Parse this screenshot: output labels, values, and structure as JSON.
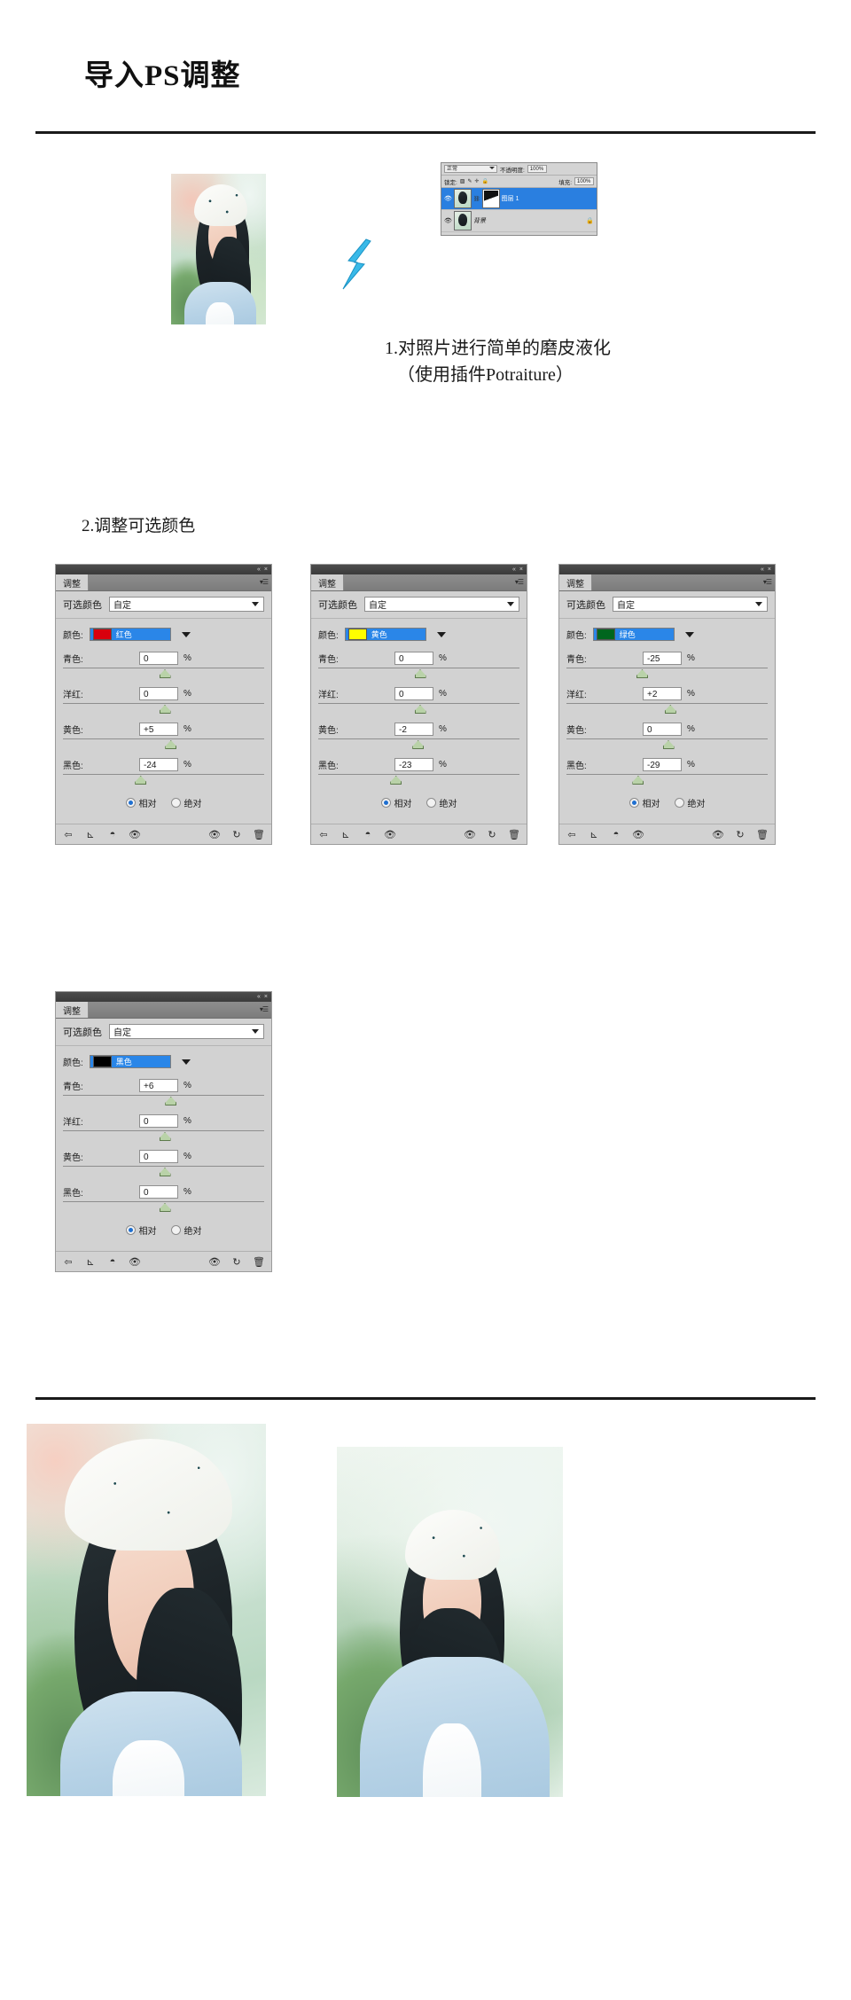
{
  "header": {
    "title": "导入PS调整"
  },
  "steps": {
    "step1_line1": "1.对照片进行简单的磨皮液化",
    "step1_line2": "（使用插件Potraiture）",
    "step2": "2.调整可选颜色"
  },
  "layers_panel": {
    "blend_mode": "正常",
    "opacity_label": "不透明度:",
    "opacity_value": "100%",
    "lock_label": "锁定:",
    "fill_label": "填充:",
    "fill_value": "100%",
    "layers": [
      {
        "name": "图层 1",
        "selected": true,
        "has_mask": true,
        "locked": false
      },
      {
        "name": "背景",
        "selected": false,
        "has_mask": false,
        "locked": true
      }
    ]
  },
  "adjustment_panels": [
    {
      "tab": "调整",
      "title": "可选颜色",
      "preset": "自定",
      "color_label": "颜色:",
      "color_name": "红色",
      "color_hex": "#d9000d",
      "sliders": [
        {
          "label": "青色:",
          "value": "0",
          "unit": "%",
          "pos": 50
        },
        {
          "label": "洋红:",
          "value": "0",
          "unit": "%",
          "pos": 50
        },
        {
          "label": "黄色:",
          "value": "+5",
          "unit": "%",
          "pos": 53
        },
        {
          "label": "黑色:",
          "value": "-24",
          "unit": "%",
          "pos": 38
        }
      ],
      "mode_relative": "相对",
      "mode_absolute": "绝对",
      "mode_selected": "相对"
    },
    {
      "tab": "调整",
      "title": "可选颜色",
      "preset": "自定",
      "color_label": "颜色:",
      "color_name": "黄色",
      "color_hex": "#ffff00",
      "sliders": [
        {
          "label": "青色:",
          "value": "0",
          "unit": "%",
          "pos": 50
        },
        {
          "label": "洋红:",
          "value": "0",
          "unit": "%",
          "pos": 50
        },
        {
          "label": "黄色:",
          "value": "-2",
          "unit": "%",
          "pos": 49
        },
        {
          "label": "黑色:",
          "value": "-23",
          "unit": "%",
          "pos": 38
        }
      ],
      "mode_relative": "相对",
      "mode_absolute": "绝对",
      "mode_selected": "相对"
    },
    {
      "tab": "调整",
      "title": "可选颜色",
      "preset": "自定",
      "color_label": "颜色:",
      "color_name": "绿色",
      "color_hex": "#00661e",
      "sliders": [
        {
          "label": "青色:",
          "value": "-25",
          "unit": "%",
          "pos": 37
        },
        {
          "label": "洋红:",
          "value": "+2",
          "unit": "%",
          "pos": 51
        },
        {
          "label": "黄色:",
          "value": "0",
          "unit": "%",
          "pos": 50
        },
        {
          "label": "黑色:",
          "value": "-29",
          "unit": "%",
          "pos": 35
        }
      ],
      "mode_relative": "相对",
      "mode_absolute": "绝对",
      "mode_selected": "相对"
    },
    {
      "tab": "调整",
      "title": "可选颜色",
      "preset": "自定",
      "color_label": "颜色:",
      "color_name": "黑色",
      "color_hex": "#000000",
      "sliders": [
        {
          "label": "青色:",
          "value": "+6",
          "unit": "%",
          "pos": 53
        },
        {
          "label": "洋红:",
          "value": "0",
          "unit": "%",
          "pos": 50
        },
        {
          "label": "黄色:",
          "value": "0",
          "unit": "%",
          "pos": 50
        },
        {
          "label": "黑色:",
          "value": "0",
          "unit": "%",
          "pos": 50
        }
      ],
      "mode_relative": "相对",
      "mode_absolute": "绝对",
      "mode_selected": "相对"
    }
  ],
  "panel_chrome": {
    "collapse": "«",
    "close": "×",
    "menu": "▾☰",
    "footer_icons": [
      "return-arrow-icon",
      "clip-to-layer-icon",
      "mask-toggle-icon",
      "preview-eye-icon",
      "view-previous-icon",
      "reset-icon",
      "delete-icon"
    ]
  }
}
